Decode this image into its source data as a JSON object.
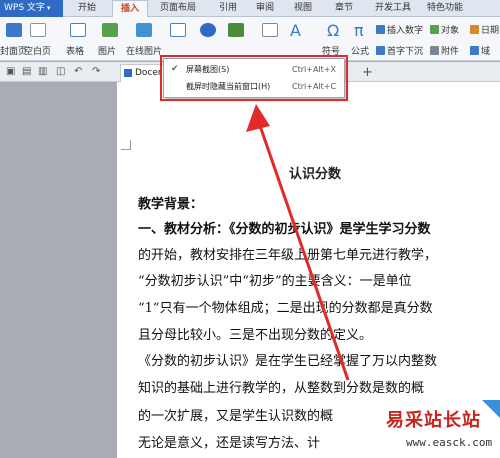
{
  "app": {
    "menu_button": "WPS 文字",
    "tabs": [
      "开始",
      "插入",
      "页面布局",
      "引用",
      "审阅",
      "视图",
      "章节",
      "开发工具",
      "特色功能"
    ],
    "active_tab": "插入"
  },
  "ribbon": {
    "items": [
      "封面页",
      "空白页",
      "表格",
      "图片",
      "在线图片",
      "截图",
      "形状",
      "图表",
      "文本框",
      "艺术字",
      "符号",
      "公式"
    ],
    "right_items": [
      "插入数字",
      "对象",
      "日期",
      "首字下沉",
      "附件",
      "域"
    ]
  },
  "quickbar": {
    "doc_tab": "Docer"
  },
  "screenshot_menu": {
    "items": [
      {
        "label": "屏幕截图(S)",
        "shortcut": "Ctrl+Alt+X",
        "checked": true
      },
      {
        "label": "截屏时隐藏当前窗口(H)",
        "shortcut": "Ctrl+Alt+C",
        "checked": false
      }
    ]
  },
  "document": {
    "title": "认识分数",
    "heading": "教学背景：",
    "lines": [
      "一、教材分析：《分数的初步认识》是学生学习分数",
      "的开始，教材安排在三年级上册第七单元进行教学，",
      "“分数初步认识”中“初步”的主要含义：一是单位",
      "“1”只有一个物体组成；二是出现的分数都是真分数",
      "且分母比较小。三是不出现分数的定义。",
      "《分数的初步认识》是在学生已经掌握了万以内整数",
      "知识的基础上进行教学的，从整数到分数是数的概",
      "的一次扩展，又是学生认识数的概",
      "无论是意义，还是读写方法、计"
    ]
  },
  "watermark": {
    "name": "易采站长站",
    "url": "www.easck.com"
  },
  "colors": {
    "accent": "#2f6bc4",
    "highlight_red": "#e12a2a",
    "active_tab_text": "#d0421b"
  }
}
